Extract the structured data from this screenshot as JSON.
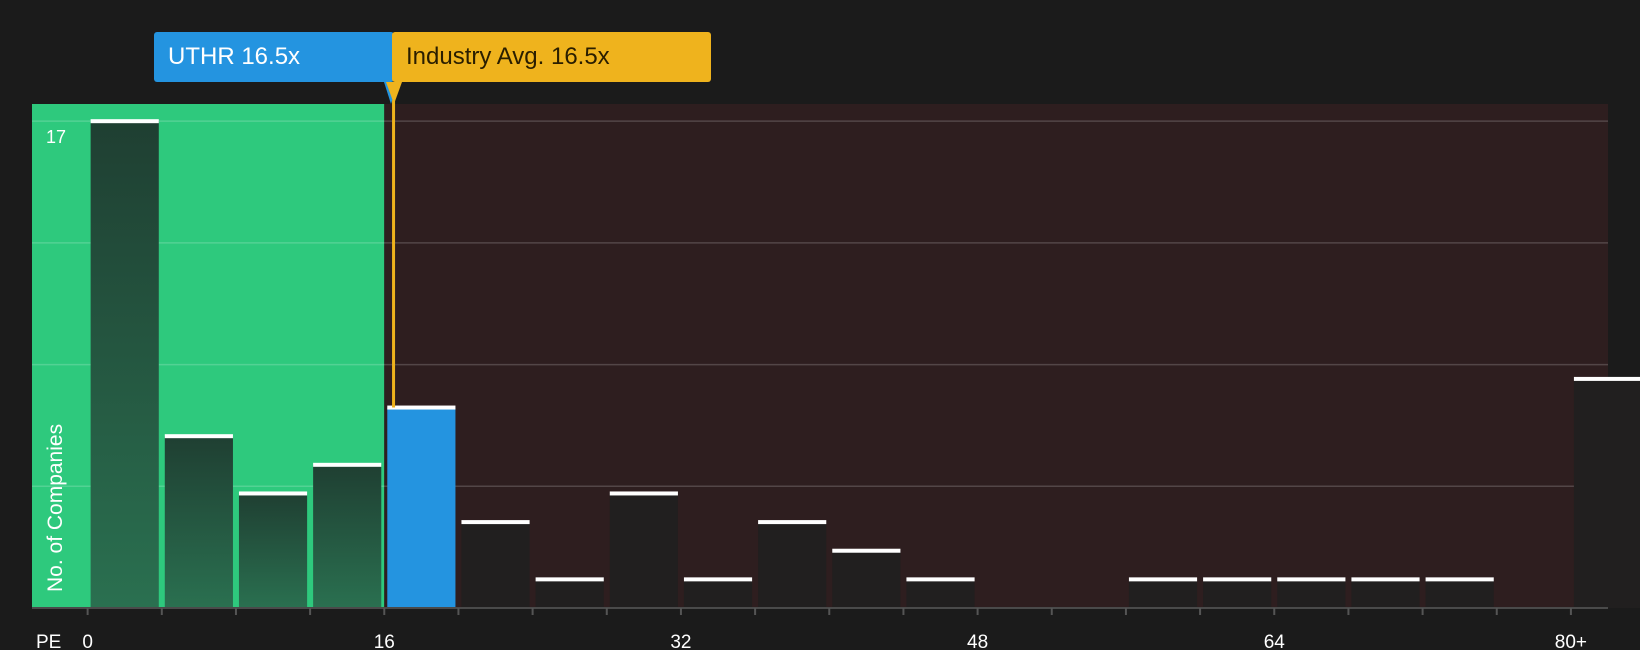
{
  "chart_data": {
    "type": "bar",
    "xlabel": "PE",
    "ylabel": "No. of Companies",
    "x_ticks": [
      "0",
      "16",
      "32",
      "48",
      "64",
      "80+"
    ],
    "x_tick_values": [
      0,
      16,
      32,
      48,
      64,
      80
    ],
    "xlim": [
      -3,
      82
    ],
    "ylim": [
      0,
      17.6
    ],
    "y_max_label": "17",
    "y_gridlines": [
      4.25,
      8.5,
      12.75,
      17
    ],
    "bin_width": 4,
    "bins": [
      {
        "start": 0,
        "count": 17
      },
      {
        "start": 4,
        "count": 6
      },
      {
        "start": 8,
        "count": 4
      },
      {
        "start": 12,
        "count": 5
      },
      {
        "start": 16,
        "count": 7,
        "highlight": true
      },
      {
        "start": 20,
        "count": 3
      },
      {
        "start": 24,
        "count": 1
      },
      {
        "start": 28,
        "count": 4
      },
      {
        "start": 32,
        "count": 1
      },
      {
        "start": 36,
        "count": 3
      },
      {
        "start": 40,
        "count": 2
      },
      {
        "start": 44,
        "count": 1
      },
      {
        "start": 56,
        "count": 1
      },
      {
        "start": 60,
        "count": 1
      },
      {
        "start": 64,
        "count": 1
      },
      {
        "start": 68,
        "count": 1
      },
      {
        "start": 72,
        "count": 1
      },
      {
        "start": 80,
        "count": 8
      }
    ],
    "green_region": [
      -3,
      16
    ],
    "red_region": [
      16,
      82
    ],
    "company": {
      "ticker": "UTHR",
      "pe": 16.5,
      "label": "UTHR 16.5x"
    },
    "industry": {
      "pe": 16.5,
      "label": "Industry Avg. 16.5x"
    },
    "colors": {
      "background": "#1b1b1b",
      "green_region": "#2ec97d",
      "red_region": "#2e1e1f",
      "company": "#2494e0",
      "industry": "#efb31d",
      "bar": "#211f1f",
      "bar_top": "#ffffff"
    }
  }
}
